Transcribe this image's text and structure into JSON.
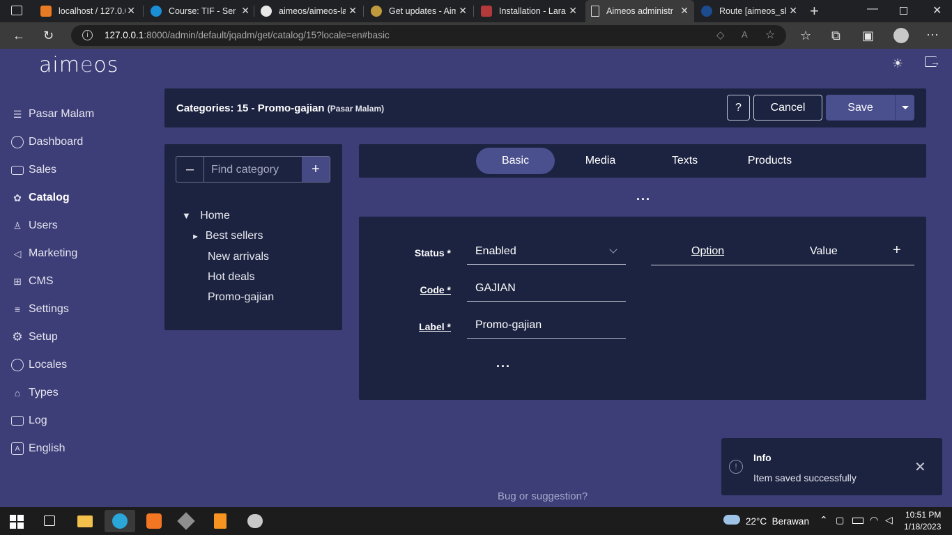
{
  "browser": {
    "tabs": [
      {
        "label": "localhost / 127.0.0"
      },
      {
        "label": "Course: TIF - Serv"
      },
      {
        "label": "aimeos/aimeos-la"
      },
      {
        "label": "Get updates - Aim"
      },
      {
        "label": "Installation - Lara"
      },
      {
        "label": "Aimeos administr"
      },
      {
        "label": "Route [aimeos_sh"
      }
    ],
    "url_host": "127.0.0.1",
    "url_rest": ":8000/admin/default/jqadm/get/catalog/15?locale=en#basic"
  },
  "app": {
    "logo_main": "aim",
    "logo_e": "e",
    "logo_end": "os"
  },
  "sidebar": {
    "items": [
      {
        "label": "Pasar Malam",
        "icon": "store-icon"
      },
      {
        "label": "Dashboard",
        "icon": "dashboard-icon"
      },
      {
        "label": "Sales",
        "icon": "sales-icon"
      },
      {
        "label": "Catalog",
        "icon": "catalog-icon"
      },
      {
        "label": "Users",
        "icon": "user-icon"
      },
      {
        "label": "Marketing",
        "icon": "megaphone-icon"
      },
      {
        "label": "CMS",
        "icon": "cms-icon"
      },
      {
        "label": "Settings",
        "icon": "sliders-icon"
      },
      {
        "label": "Setup",
        "icon": "gear-icon"
      },
      {
        "label": "Locales",
        "icon": "globe-icon"
      },
      {
        "label": "Types",
        "icon": "tag-icon"
      },
      {
        "label": "Log",
        "icon": "log-icon"
      },
      {
        "label": "English",
        "icon": "translate-icon"
      }
    ]
  },
  "header": {
    "title": "Categories: 15 - Promo-gajian",
    "subtitle": "(Pasar Malam)",
    "help_label": "?",
    "cancel_label": "Cancel",
    "save_label": "Save"
  },
  "tree": {
    "search_placeholder": "Find category",
    "root": "Home",
    "children": [
      "Best sellers",
      "New arrivals",
      "Hot deals",
      "Promo-gajian"
    ]
  },
  "tabs": [
    "Basic",
    "Media",
    "Texts",
    "Products"
  ],
  "form": {
    "status_label": "Status *",
    "status_value": "Enabled",
    "code_label": "Code *",
    "code_value": "GAJIAN",
    "label_label": "Label *",
    "label_value": "Promo-gajian",
    "option_header": "Option",
    "value_header": "Value",
    "add_symbol": "+"
  },
  "toast": {
    "title": "Info",
    "message": "Item saved successfully"
  },
  "footer": {
    "link": "Bug or suggestion?"
  },
  "taskbar": {
    "weather": "22°C  Berawan",
    "time": "10:51 PM",
    "date": "1/18/2023"
  }
}
